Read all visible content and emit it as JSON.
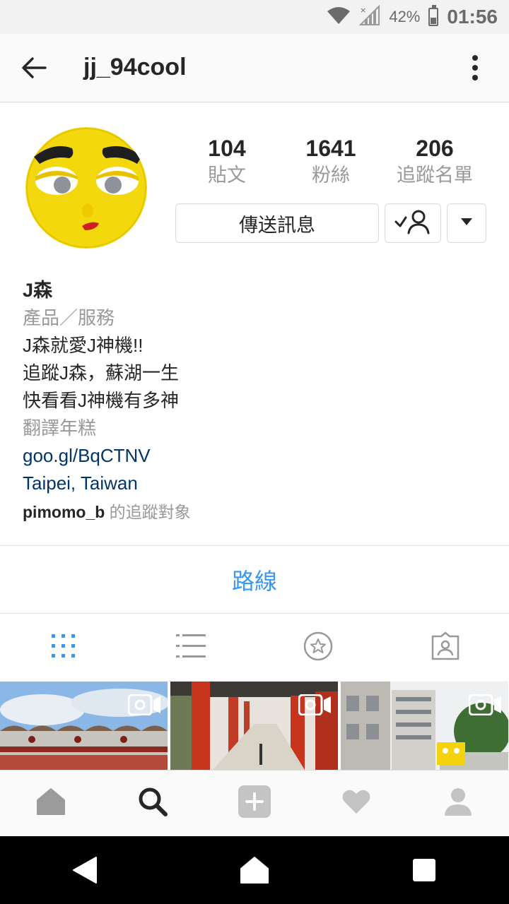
{
  "status_bar": {
    "battery": "42%",
    "time": "01:56"
  },
  "header": {
    "username": "jj_94cool"
  },
  "profile": {
    "stats": [
      {
        "value": "104",
        "label": "貼文"
      },
      {
        "value": "1641",
        "label": "粉絲"
      },
      {
        "value": "206",
        "label": "追蹤名單"
      }
    ],
    "message_button": "傳送訊息"
  },
  "bio": {
    "name": "J森",
    "category": "產品／服務",
    "lines": [
      "J森就愛J神機!!",
      "追蹤J森，蘇湖一生",
      "快看看J神機有多神"
    ],
    "translate": "翻譯年糕",
    "link": "goo.gl/BqCTNV",
    "location": "Taipei, Taiwan",
    "followed_by_user": "pimomo_b",
    "followed_by_suffix": "的追蹤對象"
  },
  "route_button": "路線",
  "colors": {
    "accent": "#3897f0",
    "link": "#003569",
    "muted": "#999999",
    "text": "#262626"
  },
  "icons": {
    "tabs": [
      "grid-icon",
      "list-icon",
      "star-icon",
      "tagged-icon"
    ],
    "bottom_nav": [
      "home-icon",
      "search-icon",
      "add-icon",
      "heart-icon",
      "profile-icon"
    ]
  }
}
